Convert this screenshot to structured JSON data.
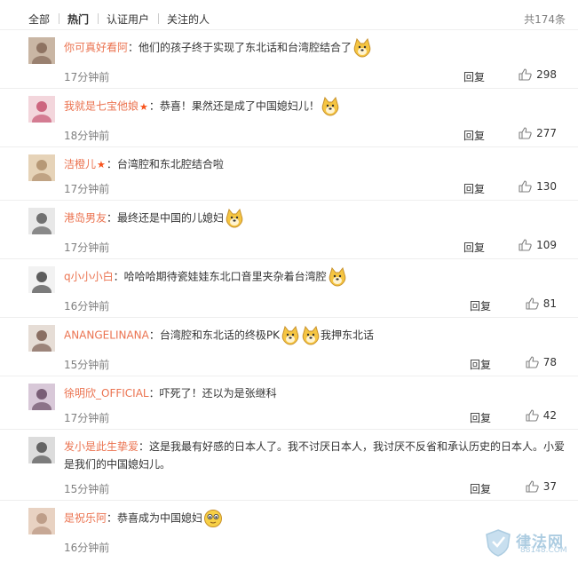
{
  "tabs": [
    {
      "label": "全部",
      "active": false
    },
    {
      "label": "热门",
      "active": true
    },
    {
      "label": "认证用户",
      "active": false
    },
    {
      "label": "关注的人",
      "active": false
    }
  ],
  "total": "共174条",
  "reply_label": "回复",
  "comments": [
    {
      "user": "你可真好看阿",
      "text": "：他们的孩子终于实现了东北话和台湾腔结合了",
      "emoticons": [
        "doge"
      ],
      "time": "17分钟前",
      "likes": "298"
    },
    {
      "user": "我就是七宝他娘",
      "vip": true,
      "text": "：恭喜！果然还是成了中国媳妇儿！",
      "emoticons": [
        "doge"
      ],
      "time": "18分钟前",
      "likes": "277"
    },
    {
      "user": "洁橙儿",
      "vip": true,
      "text": "：台湾腔和东北腔结合啦",
      "emoticons": [],
      "time": "17分钟前",
      "likes": "130"
    },
    {
      "user": "港岛男友",
      "text": "：最终还是中国的儿媳妇",
      "emoticons": [
        "doge"
      ],
      "time": "17分钟前",
      "likes": "109"
    },
    {
      "user": "q小小小白",
      "text": "：哈哈哈期待瓷娃娃东北口音里夹杂着台湾腔",
      "emoticons": [
        "doge"
      ],
      "time": "16分钟前",
      "likes": "81"
    },
    {
      "user": "ANANGELINANA",
      "text": "：台湾腔和东北话的终极PK",
      "emoticons": [
        "doge",
        "doge"
      ],
      "text_after": "我押东北话",
      "time": "15分钟前",
      "likes": "78"
    },
    {
      "user": "徐明欣_OFFICIAL",
      "text": "：吓死了！还以为是张继科",
      "emoticons": [],
      "time": "17分钟前",
      "likes": "42"
    },
    {
      "user": "发小是此生挚爱",
      "text": "：这是我最有好感的日本人了。我不讨厌日本人，我讨厌不反省和承认历史的日本人。小爱是我们的中国媳妇儿。",
      "emoticons": [],
      "time": "15分钟前",
      "likes": "37"
    },
    {
      "user": "是祝乐阿",
      "text": "：恭喜成为中国媳妇",
      "emoticons": [
        "smile"
      ],
      "time": "16分钟前",
      "likes": ""
    }
  ],
  "watermark": {
    "title": "律法网",
    "sub": "88148.COM"
  }
}
